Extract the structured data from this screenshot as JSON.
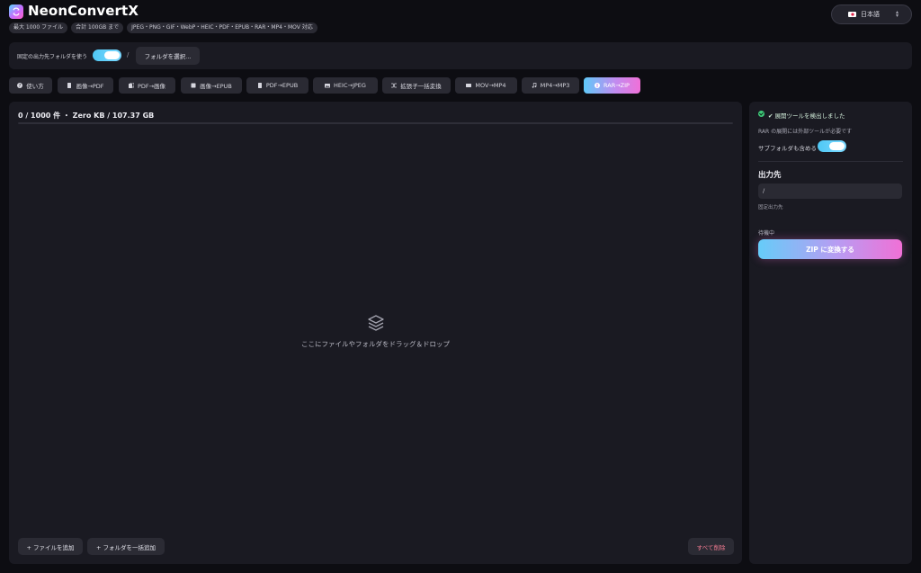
{
  "app": {
    "title": "NeonConvertX",
    "badges": [
      "最大 1000 ファイル",
      "合計 100GB まで",
      "JPEG・PNG・GIF・WebP・HEIC・PDF・EPUB・RAR・MP4・MOV 対応"
    ],
    "language": "日本語"
  },
  "folder_bar": {
    "label": "固定の出力先フォルダを使う",
    "toggle_on": true,
    "path": "/",
    "choose_label": "フォルダを選択..."
  },
  "tabs": [
    {
      "label": "使い方",
      "icon": "question-icon"
    },
    {
      "label": "画像→PDF",
      "icon": "document-icon"
    },
    {
      "label": "PDF→画像",
      "icon": "copy-icon"
    },
    {
      "label": "画像→EPUB",
      "icon": "book-icon"
    },
    {
      "label": "PDF→EPUB",
      "icon": "document-icon"
    },
    {
      "label": "HEIC→JPEG",
      "icon": "image-icon"
    },
    {
      "label": "拡張子一括変換",
      "icon": "shuffle-icon"
    },
    {
      "label": "MOV→MP4",
      "icon": "video-icon"
    },
    {
      "label": "MP4→MP3",
      "icon": "music-icon"
    },
    {
      "label": "RAR→ZIP",
      "icon": "archive-icon",
      "active": true
    }
  ],
  "main": {
    "count": "0 / 1000 件 ・ Zero KB / 107.37 GB",
    "progress": 0,
    "drop_text": "ここにファイルやフォルダをドラッグ＆ドロップ",
    "add_files": "+ ファイルを追加",
    "add_folder": "+ フォルダを一括追加",
    "delete_all": "すべて削除"
  },
  "side": {
    "detected": "✔ 展開ツールを検出しました",
    "note": "RAR の展開には外部ツールが必要です",
    "subfolder_label": "サブフォルダも含める",
    "subfolder_on": true,
    "output_heading": "出力先",
    "output_path": "/",
    "fixed_label": "固定出力先",
    "status": "待機中",
    "convert_label": "ZIP に変換する"
  },
  "colors": {
    "accent_blue": "#5fc9f8",
    "accent_pink": "#f070d8",
    "success": "#3fc97a",
    "danger_text": "#f07a90"
  }
}
